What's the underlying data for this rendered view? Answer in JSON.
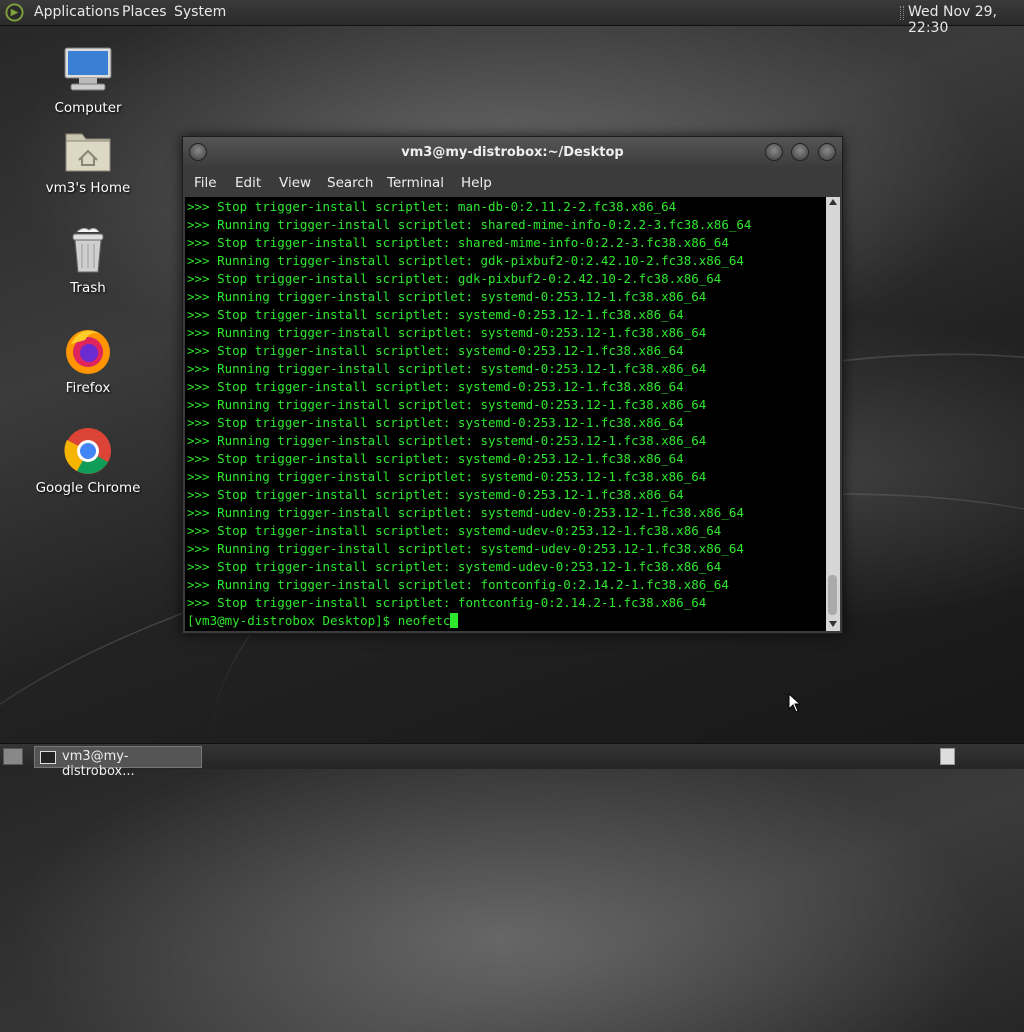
{
  "top_panel": {
    "menus": [
      "Applications",
      "Places",
      "System"
    ],
    "clock": "Wed Nov 29, 22:30"
  },
  "desktop_icons": [
    {
      "label": "Computer",
      "icon": "computer-icon"
    },
    {
      "label": "vm3's Home",
      "icon": "home-folder-icon"
    },
    {
      "label": "Trash",
      "icon": "trash-icon"
    },
    {
      "label": "Firefox",
      "icon": "firefox-icon"
    },
    {
      "label": "Google Chrome",
      "icon": "chrome-icon"
    }
  ],
  "terminal": {
    "title": "vm3@my-distrobox:~/Desktop",
    "menu": [
      "File",
      "Edit",
      "View",
      "Search",
      "Terminal",
      "Help"
    ],
    "lines": [
      ">>> Stop trigger-install scriptlet: man-db-0:2.11.2-2.fc38.x86_64",
      ">>> Running trigger-install scriptlet: shared-mime-info-0:2.2-3.fc38.x86_64",
      ">>> Stop trigger-install scriptlet: shared-mime-info-0:2.2-3.fc38.x86_64",
      ">>> Running trigger-install scriptlet: gdk-pixbuf2-0:2.42.10-2.fc38.x86_64",
      ">>> Stop trigger-install scriptlet: gdk-pixbuf2-0:2.42.10-2.fc38.x86_64",
      ">>> Running trigger-install scriptlet: systemd-0:253.12-1.fc38.x86_64",
      ">>> Stop trigger-install scriptlet: systemd-0:253.12-1.fc38.x86_64",
      ">>> Running trigger-install scriptlet: systemd-0:253.12-1.fc38.x86_64",
      ">>> Stop trigger-install scriptlet: systemd-0:253.12-1.fc38.x86_64",
      ">>> Running trigger-install scriptlet: systemd-0:253.12-1.fc38.x86_64",
      ">>> Stop trigger-install scriptlet: systemd-0:253.12-1.fc38.x86_64",
      ">>> Running trigger-install scriptlet: systemd-0:253.12-1.fc38.x86_64",
      ">>> Stop trigger-install scriptlet: systemd-0:253.12-1.fc38.x86_64",
      ">>> Running trigger-install scriptlet: systemd-0:253.12-1.fc38.x86_64",
      ">>> Stop trigger-install scriptlet: systemd-0:253.12-1.fc38.x86_64",
      ">>> Running trigger-install scriptlet: systemd-0:253.12-1.fc38.x86_64",
      ">>> Stop trigger-install scriptlet: systemd-0:253.12-1.fc38.x86_64",
      ">>> Running trigger-install scriptlet: systemd-udev-0:253.12-1.fc38.x86_64",
      ">>> Stop trigger-install scriptlet: systemd-udev-0:253.12-1.fc38.x86_64",
      ">>> Running trigger-install scriptlet: systemd-udev-0:253.12-1.fc38.x86_64",
      ">>> Stop trigger-install scriptlet: systemd-udev-0:253.12-1.fc38.x86_64",
      ">>> Running trigger-install scriptlet: fontconfig-0:2.14.2-1.fc38.x86_64",
      ">>> Stop trigger-install scriptlet: fontconfig-0:2.14.2-1.fc38.x86_64"
    ],
    "prompt": "[vm3@my-distrobox Desktop]$ ",
    "command": "neofetc",
    "text_color": "#2ee82e"
  },
  "taskbar": {
    "items": [
      {
        "label": "vm3@my-distrobox...",
        "icon": "terminal-icon"
      }
    ]
  }
}
